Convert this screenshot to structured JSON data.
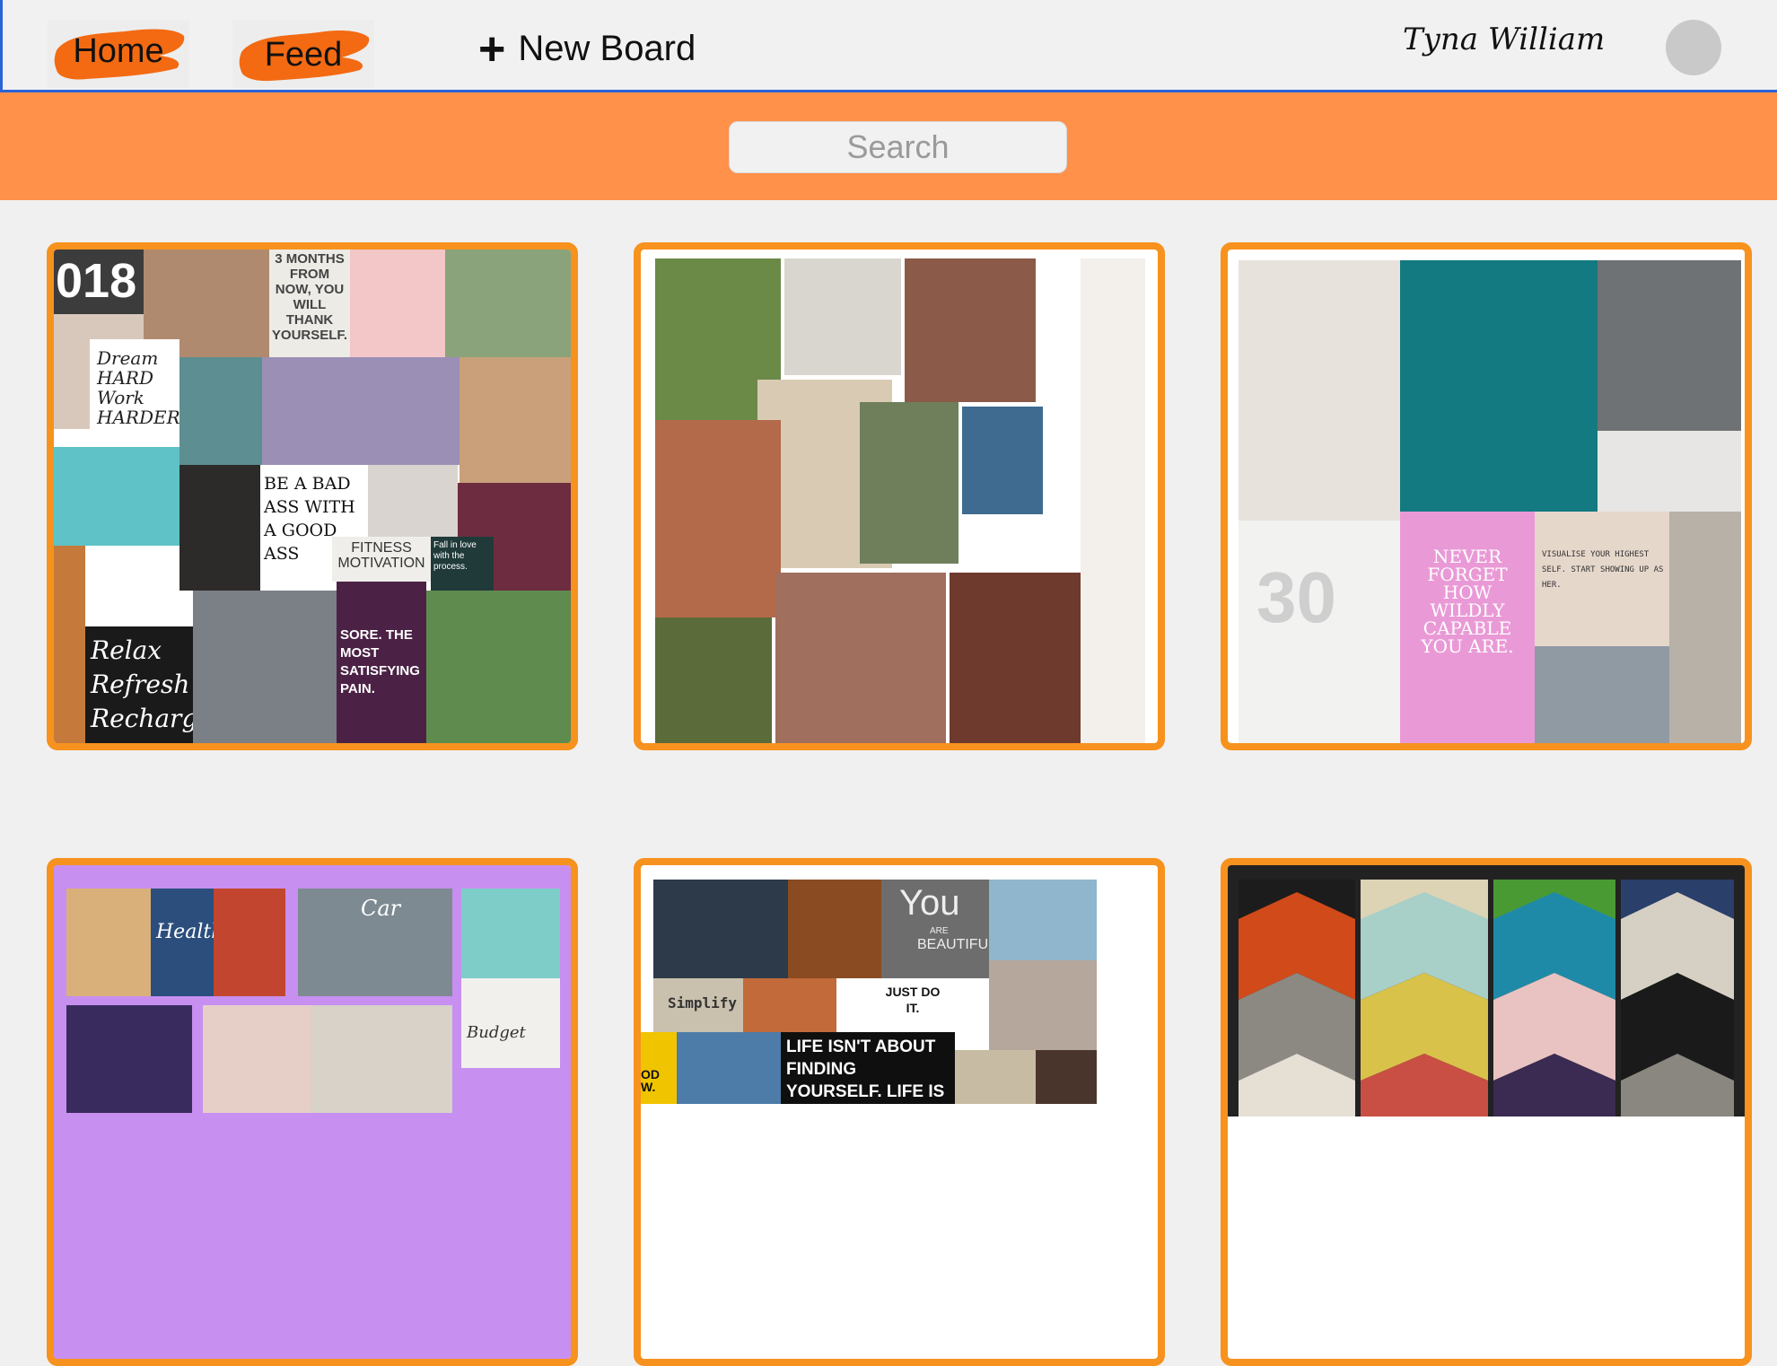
{
  "nav": {
    "home_label": "Home",
    "feed_label": "Feed",
    "new_board_label": "New Board",
    "new_board_icon": "plus-icon",
    "user_name": "Tyna William"
  },
  "search": {
    "placeholder": "Search"
  },
  "colors": {
    "accent": "#f7921e",
    "banner": "#ff914b",
    "nav_underline": "#2a63d6"
  },
  "boards": [
    {
      "texts": {
        "year": "018",
        "three_months": "3 MONTHS FROM NOW, YOU WILL THANK YOURSELF.",
        "dream": "Dream HARD Work HARDER",
        "bad_ass": "BE A BAD ASS WITH A GOOD ASS",
        "fitness": "FITNESS MOTIVATION",
        "fall": "Fall in love with the process.",
        "relax": "Relax Refresh Recharge",
        "sore": "SORE. THE MOST SATISFYING PAIN."
      }
    },
    {
      "texts": {}
    },
    {
      "texts": {
        "never": "NEVER FORGET HOW WILDLY CAPABLE YOU ARE.",
        "visualise": "VISUALISE YOUR HIGHEST SELF. START SHOWING UP AS HER.",
        "thirty": "30"
      }
    },
    {
      "texts": {
        "health": "Health",
        "car": "Car",
        "budget": "Budget"
      }
    },
    {
      "texts": {
        "you": "You",
        "are": "ARE",
        "beautiful": "BEAUTIFUL",
        "simplify": "Simplify",
        "just": "JUST DO IT.",
        "life": "LIFE ISN'T ABOUT FINDING YOURSELF. LIFE IS ABOUT CREATING",
        "od": "OD W."
      }
    },
    {
      "texts": {}
    }
  ]
}
